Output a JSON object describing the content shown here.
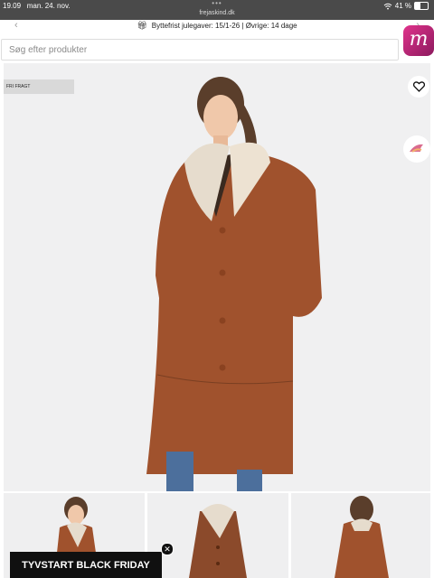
{
  "status_bar": {
    "time": "19.09",
    "date": "man. 24. nov.",
    "url": "frejaskind.dk",
    "battery": "41 %",
    "battery_level": 0.41
  },
  "announcement": {
    "text": "Byttefrist julegaver: 15/1-26 | Øvrige: 14 dage"
  },
  "search": {
    "placeholder": "Søg efter produkter"
  },
  "logo": {
    "letter": "m"
  },
  "product": {
    "badge": "FRI FRAGT"
  },
  "promo": {
    "label": "TYVSTART BLACK FRIDAY"
  },
  "icons": [
    "gift-icon",
    "heart-icon",
    "bird-icon",
    "wifi-icon",
    "battery-icon",
    "close-icon",
    "chevron-left-icon",
    "chevron-right-icon"
  ]
}
